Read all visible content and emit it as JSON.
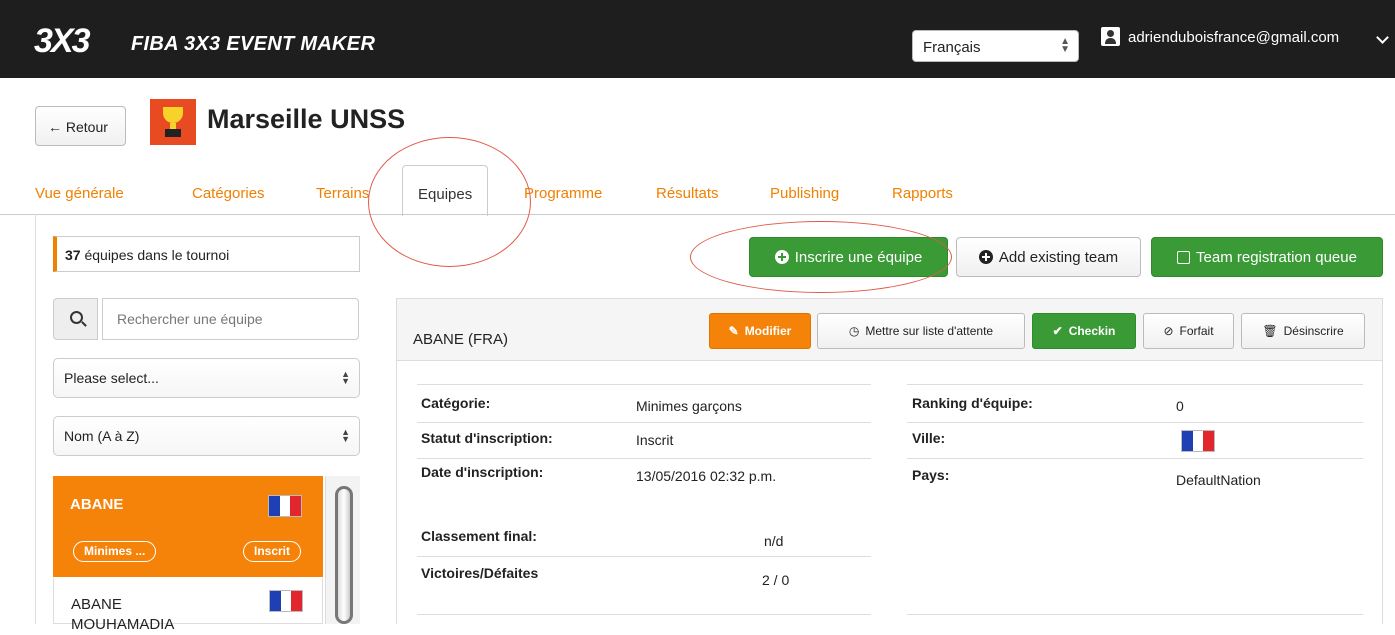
{
  "app": {
    "logo": "3X3",
    "title": "FIBA 3X3 EVENT MAKER",
    "language": "Français",
    "user_email": "adrienduboisfrance@gmail.com"
  },
  "header": {
    "back_label": "← Retour",
    "event_title": "Marseille UNSS"
  },
  "tabs": [
    {
      "label": "Vue générale"
    },
    {
      "label": "Catégories"
    },
    {
      "label": "Terrains"
    },
    {
      "label": "Equipes"
    },
    {
      "label": "Programme"
    },
    {
      "label": "Résultats"
    },
    {
      "label": "Publishing"
    },
    {
      "label": "Rapports"
    }
  ],
  "sidebar": {
    "team_count": "37",
    "team_count_text": " équipes dans le tournoi",
    "search_placeholder": "Rechercher une équipe",
    "filter_select": "Please select...",
    "sort_select": "Nom (A à Z)",
    "teams": [
      {
        "name": "ABANE",
        "category": "Minimes ...",
        "status": "Inscrit"
      },
      {
        "name": "ABANE MOUHAMADIA"
      }
    ]
  },
  "actions": {
    "register_team": "Inscrire une équipe",
    "add_existing": "Add existing team",
    "queue": "Team registration queue"
  },
  "detail": {
    "team_title": "ABANE (FRA)",
    "buttons": {
      "edit": "Modifier",
      "waitlist": "Mettre sur liste d'attente",
      "checkin": "Checkin",
      "forfeit": "Forfait",
      "unregister": "Désinscrire"
    },
    "left_fields": [
      {
        "label": "Catégorie:",
        "value": "Minimes garçons"
      },
      {
        "label": "Statut d'inscription:",
        "value": "Inscrit"
      },
      {
        "label": "Date d'inscription:",
        "value": "13/05/2016 02:32 p.m."
      },
      {
        "label": "Classement final:",
        "value": "n/d"
      },
      {
        "label": "Victoires/Défaites",
        "value": "2 / 0"
      }
    ],
    "right_fields": [
      {
        "label": "Ranking d'équipe:",
        "value": "0"
      },
      {
        "label": "Ville:",
        "value": ""
      },
      {
        "label": "Pays:",
        "value": "DefaultNation"
      }
    ]
  },
  "colors": {
    "accent_orange": "#f5830a",
    "success_green": "#3a9a36",
    "topbar": "#1e1e1e",
    "annotation_red": "#e05a4a"
  }
}
